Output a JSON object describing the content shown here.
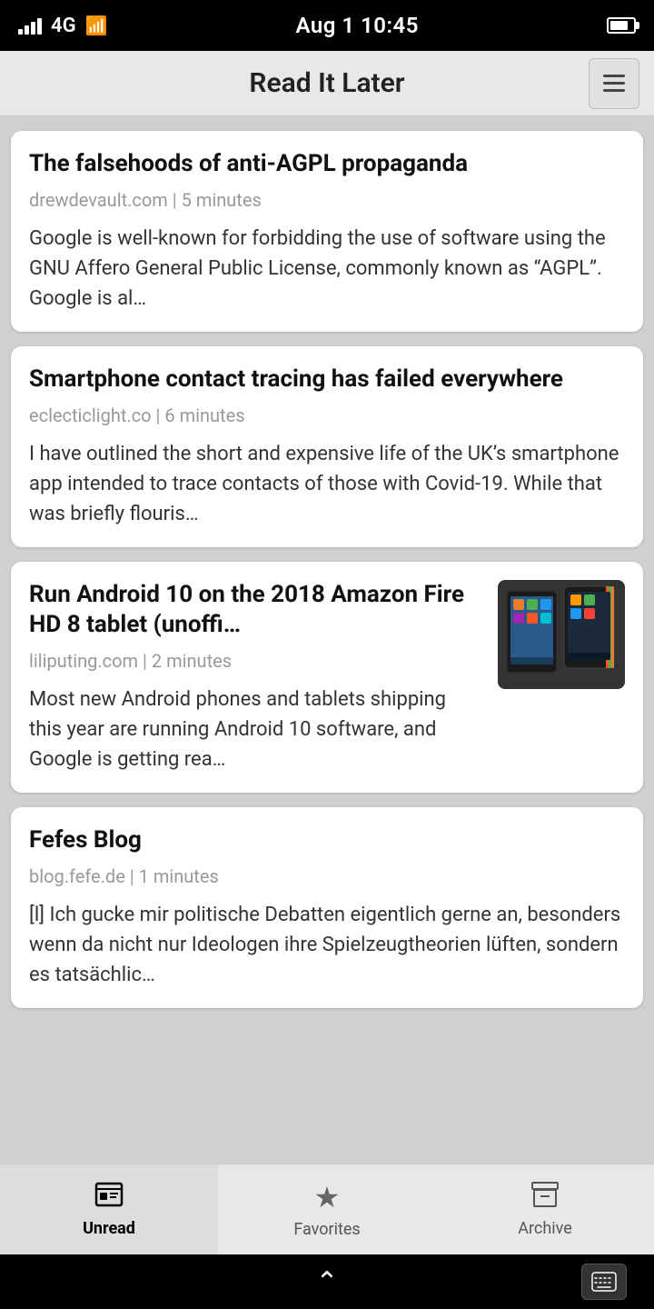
{
  "statusBar": {
    "carrier": "4G",
    "time": "Aug 1  10:45",
    "batteryLevel": 80
  },
  "header": {
    "title": "Read It Later",
    "menuLabel": "Menu"
  },
  "articles": [
    {
      "id": 1,
      "title": "The falsehoods of anti-AGPL propaganda",
      "source": "drewdevault.com",
      "readTime": "5 minutes",
      "excerpt": "Google is well-known for forbidding the use of software using the GNU Affero General Public License, commonly known as “AGPL”. Google is al…",
      "hasImage": false
    },
    {
      "id": 2,
      "title": "Smartphone contact tracing has failed everywhere",
      "source": "eclecticlight.co",
      "readTime": "6 minutes",
      "excerpt": "I have outlined the short and expensive life of the UK’s smartphone app intended to trace contacts of those with Covid-19. While that was briefly flouris…",
      "hasImage": false
    },
    {
      "id": 3,
      "title": "Run Android 10 on the 2018 Amazon Fire HD 8 tablet (unoffi…",
      "source": "liliputing.com",
      "readTime": "2 minutes",
      "excerpt": "Most new Android phones and tablets shipping this year are running Android 10 software, and Google is getting rea…",
      "hasImage": true
    },
    {
      "id": 4,
      "title": "Fefes Blog",
      "source": "blog.fefe.de",
      "readTime": "1 minutes",
      "excerpt": "[l] Ich gucke mir politische Debatten eigentlich gerne an, besonders wenn da nicht nur Ideologen ihre Spielzeugtheorien lüften, sondern es tatsächlic…",
      "hasImage": false
    }
  ],
  "bottomNav": {
    "tabs": [
      {
        "id": "unread",
        "label": "Unread",
        "icon": "📰",
        "active": true
      },
      {
        "id": "favorites",
        "label": "Favorites",
        "icon": "★",
        "active": false
      },
      {
        "id": "archive",
        "label": "Archive",
        "icon": "🗂",
        "active": false
      }
    ]
  },
  "androidBar": {
    "chevronLabel": "^",
    "keyboardLabel": "⌨"
  }
}
